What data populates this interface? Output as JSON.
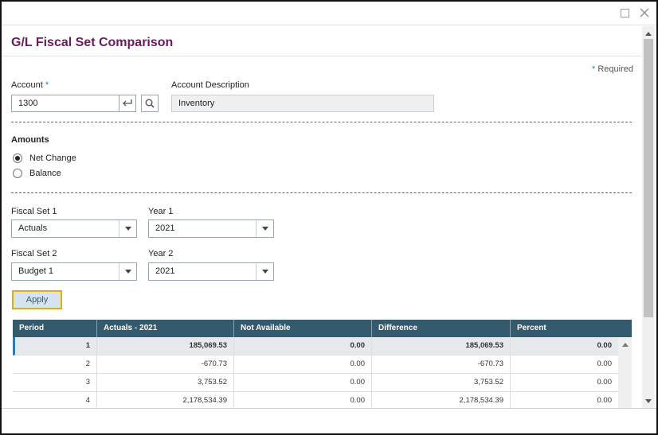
{
  "window": {
    "maximize_icon": "maximize-icon",
    "close_icon": "close-icon"
  },
  "header": {
    "title": "G/L Fiscal Set Comparison"
  },
  "required_note": {
    "star": "*",
    "text": "Required"
  },
  "account": {
    "label": "Account",
    "required_star": "*",
    "value": "1300",
    "enter_icon": "enter-icon",
    "search_icon": "search-icon"
  },
  "account_description": {
    "label": "Account Description",
    "value": "Inventory"
  },
  "amounts": {
    "title": "Amounts",
    "options": [
      {
        "label": "Net Change",
        "checked": true
      },
      {
        "label": "Balance",
        "checked": false
      }
    ]
  },
  "fiscal_set_1": {
    "label": "Fiscal Set 1",
    "value": "Actuals"
  },
  "year_1": {
    "label": "Year 1",
    "value": "2021"
  },
  "fiscal_set_2": {
    "label": "Fiscal Set 2",
    "value": "Budget 1"
  },
  "year_2": {
    "label": "Year 2",
    "value": "2021"
  },
  "apply_button": {
    "label": "Apply"
  },
  "grid": {
    "columns": [
      "Period",
      "Actuals - 2021",
      "Not Available",
      "Difference",
      "Percent"
    ],
    "rows": [
      {
        "period": "1",
        "actuals": "185,069.53",
        "not_available": "0.00",
        "difference": "185,069.53",
        "percent": "0.00"
      },
      {
        "period": "2",
        "actuals": "-670.73",
        "not_available": "0.00",
        "difference": "-670.73",
        "percent": "0.00"
      },
      {
        "period": "3",
        "actuals": "3,753.52",
        "not_available": "0.00",
        "difference": "3,753.52",
        "percent": "0.00"
      },
      {
        "period": "4",
        "actuals": "2,178,534.39",
        "not_available": "0.00",
        "difference": "2,178,534.39",
        "percent": "0.00"
      }
    ]
  },
  "colors": {
    "title": "#6a1b5e",
    "grid_header": "#345a6d",
    "accent": "#2b7bb9",
    "apply_border": "#e0b000"
  }
}
